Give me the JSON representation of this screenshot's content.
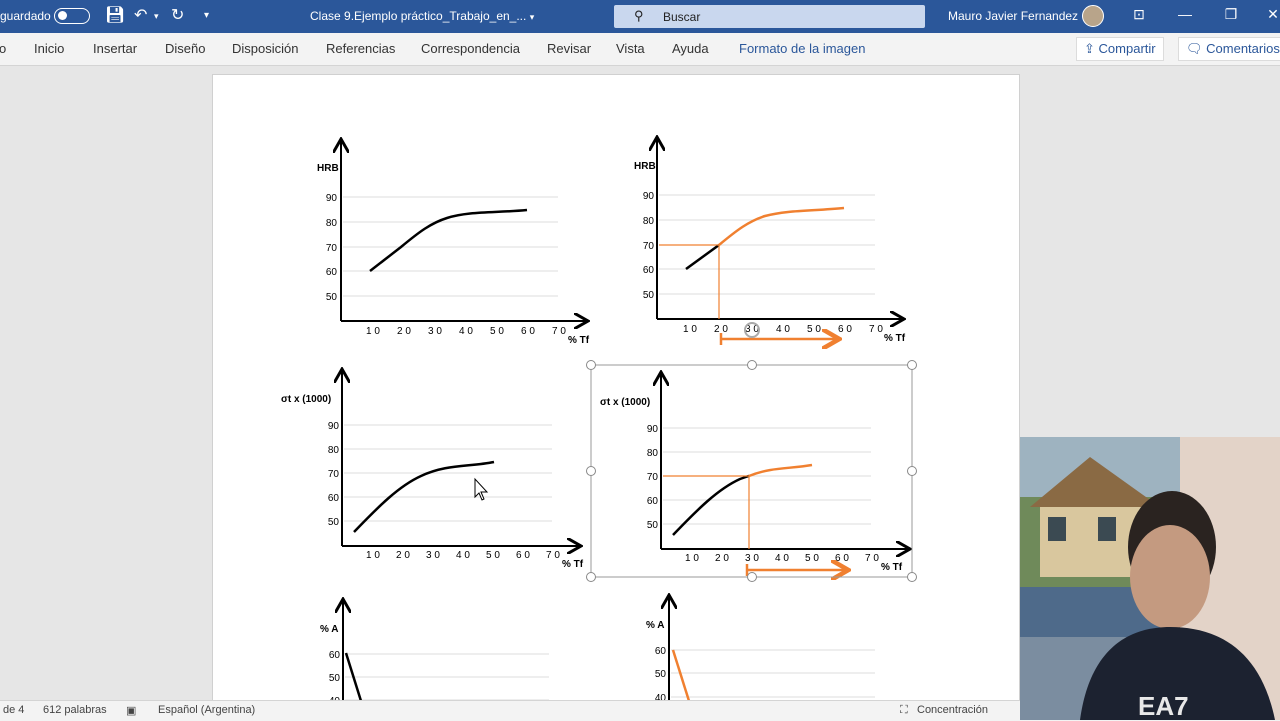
{
  "titlebar": {
    "autosave_label": "guardado",
    "doc_title": "Clase 9.Ejemplo práctico_Trabajo_en_...",
    "search_placeholder": "Buscar",
    "user_name": "Mauro Javier Fernandez"
  },
  "ribbon": {
    "tabs": [
      "o",
      "Inicio",
      "Insertar",
      "Diseño",
      "Disposición",
      "Referencias",
      "Correspondencia",
      "Revisar",
      "Vista",
      "Ayuda",
      "Formato de la imagen"
    ],
    "share": "Compartir",
    "comments": "Comentarios"
  },
  "charts": {
    "x_ticks": [
      "1 0",
      "2 0",
      "3 0",
      "4 0",
      "5 0",
      "6 0",
      "7 0"
    ],
    "x_label": "% Tf",
    "hrb": {
      "label": "HRB",
      "ticks": [
        "90",
        "80",
        "70",
        "60",
        "50"
      ]
    },
    "sigma": {
      "label": "σt x (1000)",
      "ticks": [
        "90",
        "80",
        "70",
        "60",
        "50"
      ]
    },
    "elong": {
      "label": "% A",
      "ticks": [
        "60",
        "50",
        "40"
      ]
    }
  },
  "status": {
    "page": "de 4",
    "words": "612 palabras",
    "language": "Español (Argentina)",
    "focus": "Concentración"
  },
  "colors": {
    "accent": "#2b579a",
    "orange": "#f08030"
  }
}
